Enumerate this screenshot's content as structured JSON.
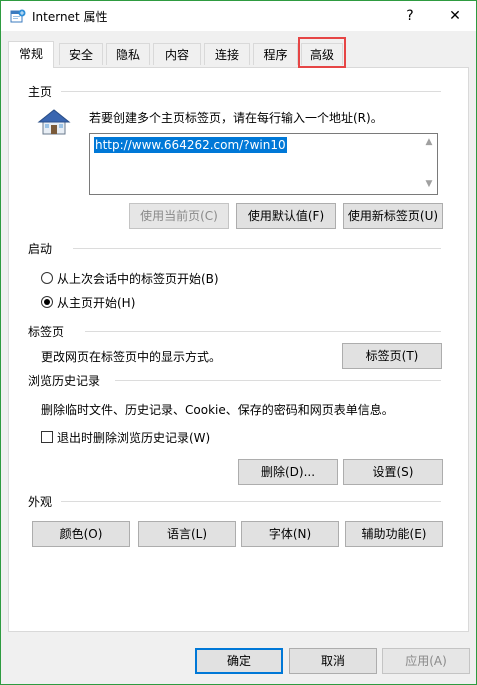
{
  "window": {
    "title": "Internet 属性",
    "help_glyph": "?",
    "close_glyph": "✕"
  },
  "tabs": [
    {
      "label": "常规"
    },
    {
      "label": "安全"
    },
    {
      "label": "隐私"
    },
    {
      "label": "内容"
    },
    {
      "label": "连接"
    },
    {
      "label": "程序"
    },
    {
      "label": "高级"
    }
  ],
  "homepage": {
    "heading": "主页",
    "description": "若要创建多个主页标签页，请在每行输入一个地址(R)。",
    "url": "http://www.664262.com/?win10",
    "use_current": "使用当前页(C)",
    "use_default": "使用默认值(F)",
    "use_new_tab": "使用新标签页(U)"
  },
  "startup": {
    "heading": "启动",
    "option_last_session": "从上次会话中的标签页开始(B)",
    "option_homepage": "从主页开始(H)"
  },
  "tabs_section": {
    "heading": "标签页",
    "description": "更改网页在标签页中的显示方式。",
    "button": "标签页(T)"
  },
  "history": {
    "heading": "浏览历史记录",
    "description": "删除临时文件、历史记录、Cookie、保存的密码和网页表单信息。",
    "checkbox_label": "退出时删除浏览历史记录(W)",
    "delete_button": "删除(D)...",
    "settings_button": "设置(S)"
  },
  "appearance": {
    "heading": "外观",
    "colors": "颜色(O)",
    "languages": "语言(L)",
    "fonts": "字体(N)",
    "accessibility": "辅助功能(E)"
  },
  "footer": {
    "ok": "确定",
    "cancel": "取消",
    "apply": "应用(A)"
  },
  "colors": {
    "accent": "#0078d7",
    "highlight_border": "#e64545",
    "window_border": "#2e9b40"
  }
}
